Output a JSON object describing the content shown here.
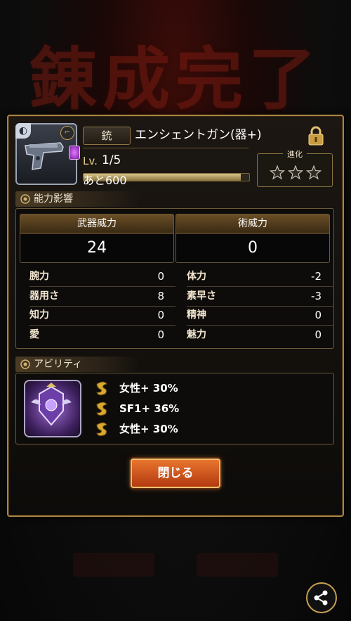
{
  "background": {
    "title_text": "錬成完了"
  },
  "weapon": {
    "category": "銃",
    "name": "エンシェントガン(器+)",
    "level_label": "Lv.",
    "level_value": "1/5",
    "exp_remaining": "あと600",
    "exp_progress": 0.95,
    "evolution_label": "進化",
    "evolution_stars": 3
  },
  "sections": {
    "stats_title": "能力影響",
    "ability_title": "アビリティ"
  },
  "power": {
    "weapon_label": "武器威力",
    "weapon_value": "24",
    "magic_label": "術威力",
    "magic_value": "0"
  },
  "stats": {
    "left": [
      {
        "label": "腕力",
        "value": "0"
      },
      {
        "label": "器用さ",
        "value": "8"
      },
      {
        "label": "知力",
        "value": "0"
      },
      {
        "label": "愛",
        "value": "0"
      }
    ],
    "right": [
      {
        "label": "体力",
        "value": "-2"
      },
      {
        "label": "素早さ",
        "value": "-3"
      },
      {
        "label": "精神",
        "value": "0"
      },
      {
        "label": "魅力",
        "value": "0"
      }
    ]
  },
  "abilities": [
    {
      "text": "女性+ 30%"
    },
    {
      "text": "SF1+ 36%"
    },
    {
      "text": "女性+ 30%"
    }
  ],
  "buttons": {
    "close_label": "閉じる"
  },
  "icons": {
    "lock": "lock-icon",
    "share": "share-icon",
    "gear": "gear-icon",
    "ability_swirl": "ability-swirl-icon",
    "weapon": "gun-icon"
  },
  "colors": {
    "accent_gold": "#a88443",
    "button_orange": "#d95a20"
  }
}
